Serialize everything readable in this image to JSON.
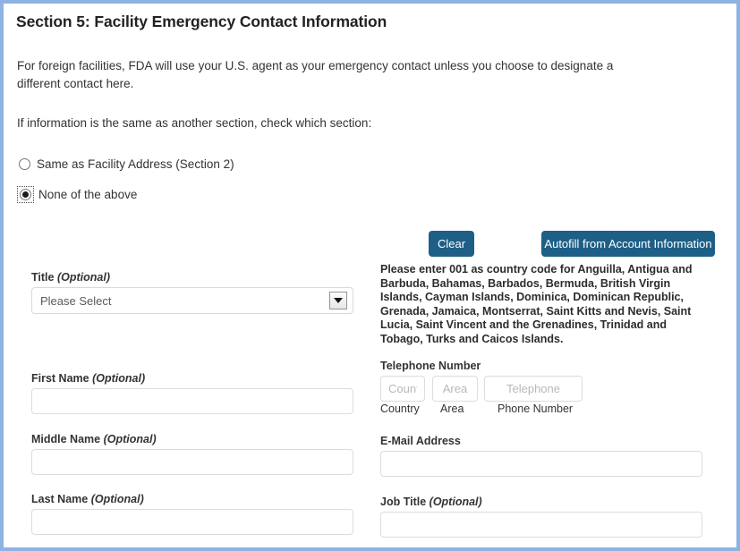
{
  "section": {
    "title": "Section 5: Facility Emergency Contact Information",
    "intro": "For foreign facilities, FDA will use your U.S. agent as your emergency contact unless you choose to designate a different contact here.",
    "check_prompt": "If information is the same as another section, check which section:"
  },
  "radios": {
    "same_as_facility": {
      "label": "Same as Facility Address (Section 2)",
      "checked": false
    },
    "none_of_the_above": {
      "label": "None of the above",
      "checked": true
    }
  },
  "buttons": {
    "clear": "Clear",
    "autofill": "Autofill from Account Information"
  },
  "notes": {
    "country_code": "Please enter 001 as country code for Anguilla, Antigua and Barbuda, Bahamas, Barbados, Bermuda, British Virgin Islands, Cayman Islands, Dominica, Dominican Republic, Grenada, Jamaica, Montserrat, Saint Kitts and Nevis, Saint Lucia, Saint Vincent and the Grenadines, Trinidad and Tobago, Turks and Caicos Islands."
  },
  "fields": {
    "title": {
      "label": "Title",
      "optional": "(Optional)",
      "selected": "Please Select",
      "options": [
        "Please Select"
      ]
    },
    "first_name": {
      "label": "First Name",
      "optional": "(Optional)",
      "value": "",
      "placeholder": ""
    },
    "middle_name": {
      "label": "Middle Name",
      "optional": "(Optional)",
      "value": "",
      "placeholder": ""
    },
    "last_name": {
      "label": "Last Name",
      "optional": "(Optional)",
      "value": "",
      "placeholder": ""
    },
    "telephone": {
      "label": "Telephone Number",
      "country": {
        "placeholder": "Country",
        "value": "",
        "under_label": "Country"
      },
      "area": {
        "placeholder": "Area",
        "value": "",
        "under_label": "Area"
      },
      "number": {
        "placeholder": "Telephone",
        "value": "",
        "under_label": "Phone Number"
      }
    },
    "email": {
      "label": "E-Mail Address",
      "optional": "",
      "value": "",
      "placeholder": ""
    },
    "job_title": {
      "label": "Job Title",
      "optional": "(Optional)",
      "value": "",
      "placeholder": ""
    }
  },
  "colors": {
    "button_blue": "#1d5f87",
    "page_border": "#8cb3e2",
    "input_border": "#dcdcdc"
  }
}
